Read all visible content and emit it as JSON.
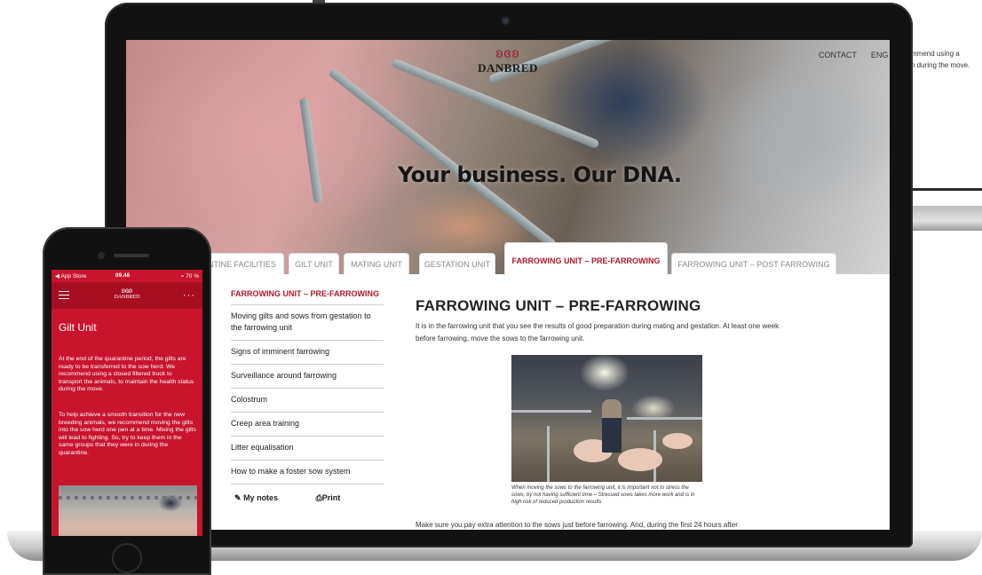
{
  "background_page": {
    "text": [
      "mmend using a",
      "n during the move."
    ]
  },
  "laptop": {
    "site": {
      "logo_mark": "ʚɞʚ",
      "logo_text": "DANBRED",
      "nav": [
        "CONTACT",
        "ENG"
      ],
      "tagline": "Your business. Our DNA.",
      "tabs": [
        {
          "label": "NTINE FACILITIES"
        },
        {
          "label": "GILT UNIT"
        },
        {
          "label": "MATING UNIT"
        },
        {
          "label": "GESTATION UNIT"
        },
        {
          "label": "FARROWING UNIT – PRE-FARROWING",
          "active": true
        },
        {
          "label": "FARROWING UNIT – POST FARROWING"
        }
      ],
      "sidebar": {
        "title": "FARROWING UNIT – PRE-FARROWING",
        "items": [
          "Moving gilts and sows from gestation to the farrowing unit",
          "Signs of imminent farrowing",
          "Surveillance around farrowing",
          "Colostrum",
          "Creep area training",
          "Litter equalisation",
          "How to make a foster sow system"
        ],
        "my_notes": "My notes",
        "print": "Print"
      },
      "article": {
        "heading": "FARROWING UNIT – PRE-FARROWING",
        "intro": "It is in the farrowing unit that you see the results of good preparation during mating and gestation. At least one week before farrowing, move the sows to the farrowing unit.",
        "caption": "When moving the sows to the farrowing unit, it is important not to stress the sows, by not having sufficient time – Stressed sows takes more work and is in high risk of reduced production results",
        "bottom_text": "Make sure you pay extra attention to the sows just before farrowing. And, during the first 24 hours after"
      }
    }
  },
  "phone": {
    "status": {
      "left": "◀ App Store",
      "time": "09.46",
      "right": "⌁ 70 %"
    },
    "appbar": {
      "logo_mark": "ʚɞʚ",
      "logo_text": "DANBRED",
      "more": "···"
    },
    "title": "Gilt Unit",
    "paragraphs": [
      "At the end of the quarantine period, the gilts are ready to be transferred to the sow herd. We recommend using a closed filtered truck to transport the animals, to maintain the health status during the move.",
      "To help achieve a smooth transition for the new breeding animals, we recommend moving the gilts into the sow herd one pen at a time. Mixing the gilts will lead to fighting. So, try to keep them in the same groups that they were in during the quarantine."
    ]
  },
  "colors": {
    "brand_red": "#b0182c",
    "phone_red": "#c8142c"
  }
}
